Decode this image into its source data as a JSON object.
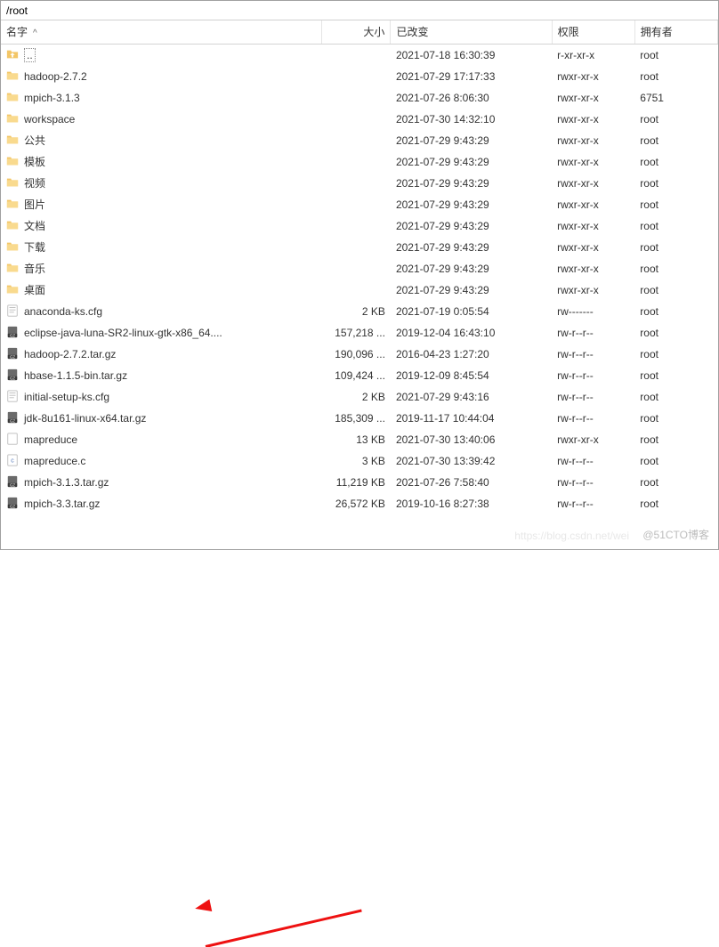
{
  "path": "/root",
  "columns": {
    "name": "名字",
    "size": "大小",
    "changed": "已改变",
    "perm": "权限",
    "owner": "拥有者"
  },
  "sort_indicator": "^",
  "rows": [
    {
      "icon": "up",
      "name": "..",
      "size": "",
      "date": "2021-07-18 16:30:39",
      "perm": "r-xr-xr-x",
      "owner": "root"
    },
    {
      "icon": "folder",
      "name": "hadoop-2.7.2",
      "size": "",
      "date": "2021-07-29 17:17:33",
      "perm": "rwxr-xr-x",
      "owner": "root"
    },
    {
      "icon": "folder",
      "name": "mpich-3.1.3",
      "size": "",
      "date": "2021-07-26 8:06:30",
      "perm": "rwxr-xr-x",
      "owner": "6751"
    },
    {
      "icon": "folder",
      "name": "workspace",
      "size": "",
      "date": "2021-07-30 14:32:10",
      "perm": "rwxr-xr-x",
      "owner": "root"
    },
    {
      "icon": "folder",
      "name": "公共",
      "size": "",
      "date": "2021-07-29 9:43:29",
      "perm": "rwxr-xr-x",
      "owner": "root"
    },
    {
      "icon": "folder",
      "name": "模板",
      "size": "",
      "date": "2021-07-29 9:43:29",
      "perm": "rwxr-xr-x",
      "owner": "root"
    },
    {
      "icon": "folder",
      "name": "视频",
      "size": "",
      "date": "2021-07-29 9:43:29",
      "perm": "rwxr-xr-x",
      "owner": "root"
    },
    {
      "icon": "folder",
      "name": "图片",
      "size": "",
      "date": "2021-07-29 9:43:29",
      "perm": "rwxr-xr-x",
      "owner": "root"
    },
    {
      "icon": "folder",
      "name": "文档",
      "size": "",
      "date": "2021-07-29 9:43:29",
      "perm": "rwxr-xr-x",
      "owner": "root"
    },
    {
      "icon": "folder",
      "name": "下载",
      "size": "",
      "date": "2021-07-29 9:43:29",
      "perm": "rwxr-xr-x",
      "owner": "root"
    },
    {
      "icon": "folder",
      "name": "音乐",
      "size": "",
      "date": "2021-07-29 9:43:29",
      "perm": "rwxr-xr-x",
      "owner": "root"
    },
    {
      "icon": "folder",
      "name": "桌面",
      "size": "",
      "date": "2021-07-29 9:43:29",
      "perm": "rwxr-xr-x",
      "owner": "root"
    },
    {
      "icon": "file",
      "name": "anaconda-ks.cfg",
      "size": "2 KB",
      "date": "2021-07-19 0:05:54",
      "perm": "rw-------",
      "owner": "root"
    },
    {
      "icon": "gz",
      "name": "eclipse-java-luna-SR2-linux-gtk-x86_64....",
      "size": "157,218 ...",
      "date": "2019-12-04 16:43:10",
      "perm": "rw-r--r--",
      "owner": "root"
    },
    {
      "icon": "gz",
      "name": "hadoop-2.7.2.tar.gz",
      "size": "190,096 ...",
      "date": "2016-04-23 1:27:20",
      "perm": "rw-r--r--",
      "owner": "root"
    },
    {
      "icon": "gz",
      "name": "hbase-1.1.5-bin.tar.gz",
      "size": "109,424 ...",
      "date": "2019-12-09 8:45:54",
      "perm": "rw-r--r--",
      "owner": "root"
    },
    {
      "icon": "file",
      "name": "initial-setup-ks.cfg",
      "size": "2 KB",
      "date": "2021-07-29 9:43:16",
      "perm": "rw-r--r--",
      "owner": "root"
    },
    {
      "icon": "gz",
      "name": "jdk-8u161-linux-x64.tar.gz",
      "size": "185,309 ...",
      "date": "2019-11-17 10:44:04",
      "perm": "rw-r--r--",
      "owner": "root"
    },
    {
      "icon": "blank",
      "name": "mapreduce",
      "size": "13 KB",
      "date": "2021-07-30 13:40:06",
      "perm": "rwxr-xr-x",
      "owner": "root"
    },
    {
      "icon": "c",
      "name": "mapreduce.c",
      "size": "3 KB",
      "date": "2021-07-30 13:39:42",
      "perm": "rw-r--r--",
      "owner": "root"
    },
    {
      "icon": "gz",
      "name": "mpich-3.1.3.tar.gz",
      "size": "11,219 KB",
      "date": "2021-07-26 7:58:40",
      "perm": "rw-r--r--",
      "owner": "root"
    },
    {
      "icon": "gz",
      "name": "mpich-3.3.tar.gz",
      "size": "26,572 KB",
      "date": "2019-10-16 8:27:38",
      "perm": "rw-r--r--",
      "owner": "root"
    }
  ],
  "watermark_main": "@51CTO博客",
  "watermark_faint": "https://blog.csdn.net/wei"
}
